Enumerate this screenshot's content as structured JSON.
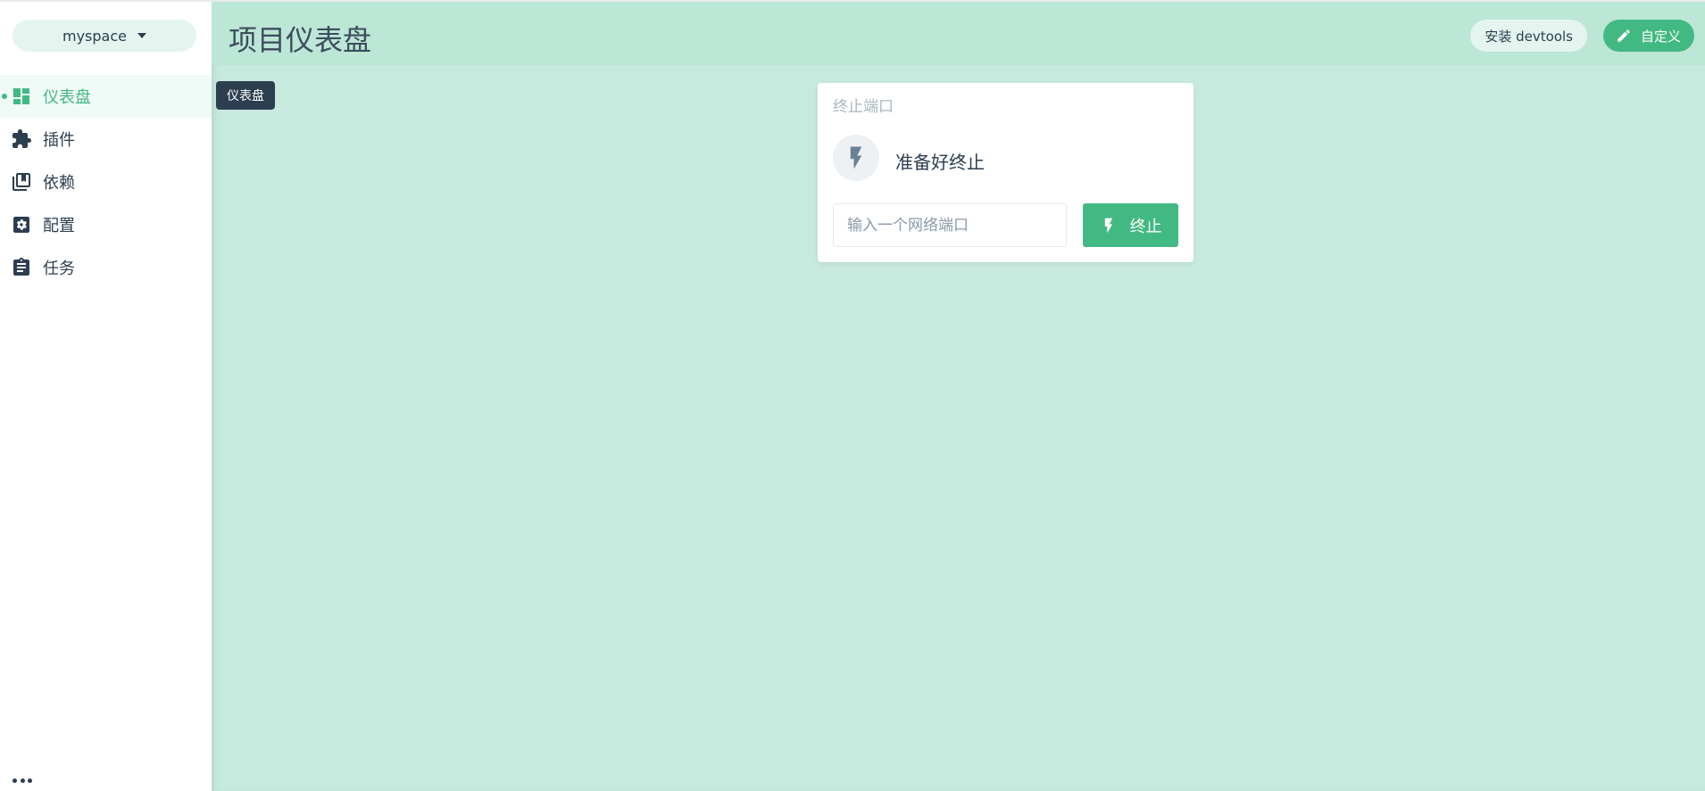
{
  "sidebar": {
    "project_name": "myspace",
    "items": [
      {
        "label": "仪表盘",
        "icon": "dashboard-icon",
        "active": true
      },
      {
        "label": "插件",
        "icon": "puzzle-icon",
        "active": false
      },
      {
        "label": "依赖",
        "icon": "library-icon",
        "active": false
      },
      {
        "label": "配置",
        "icon": "settings-icon",
        "active": false
      },
      {
        "label": "任务",
        "icon": "clipboard-icon",
        "active": false
      }
    ],
    "more_icon": "more-icon"
  },
  "header": {
    "title": "项目仪表盘",
    "devtools_label": "安装 devtools",
    "customize_label": "自定义",
    "customize_icon": "pencil-icon"
  },
  "tooltip": {
    "text": "仪表盘"
  },
  "widget": {
    "title": "终止端口",
    "status_icon": "lightning-icon",
    "status_text": "准备好终止",
    "input_placeholder": "输入一个网络端口",
    "input_value": "",
    "kill_label": "终止",
    "kill_icon": "lightning-icon"
  },
  "colors": {
    "accent": "#42b983",
    "main_bg": "#c8eade",
    "header_bg": "#bce6d6",
    "dark": "#2c3e50"
  }
}
